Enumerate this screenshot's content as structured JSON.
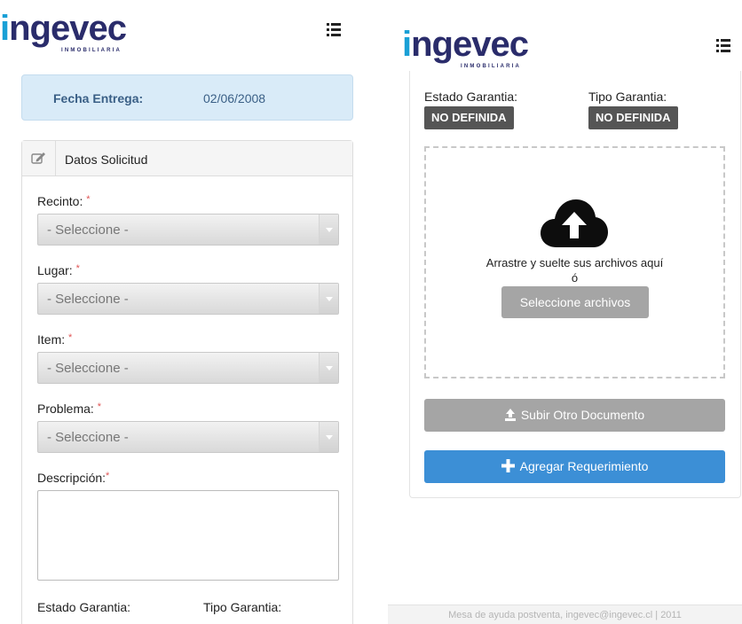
{
  "brand": {
    "logo_text": "ingevec",
    "logo_lead": "i",
    "logo_rest": "ngevec",
    "logo_sub": "INMOBILIARIA"
  },
  "left": {
    "fecha_label": "Fecha Entrega:",
    "fecha_value": "02/06/2008",
    "panel_title": "Datos Solicitud",
    "fields": [
      {
        "label": "Recinto:",
        "required": "*",
        "value": "- Seleccione -"
      },
      {
        "label": "Lugar:",
        "required": "*",
        "value": "- Seleccione -"
      },
      {
        "label": "Item:",
        "required": "*",
        "value": "- Seleccione -"
      },
      {
        "label": "Problema:",
        "required": "*",
        "value": "- Seleccione -"
      }
    ],
    "descripcion_label": "Descripción:",
    "descripcion_required": "*",
    "estado_label": "Estado Garantia:",
    "tipo_label": "Tipo Garantia:"
  },
  "right": {
    "estado_label": "Estado Garantia:",
    "estado_value": "NO DEFINIDA",
    "tipo_label": "Tipo Garantia:",
    "tipo_value": "NO DEFINIDA",
    "drop_text": "Arrastre y suelte sus archivos aquí",
    "drop_or": "ó",
    "select_files_label": "Seleccione archivos",
    "upload_other_label": "Subir Otro Documento",
    "add_requirement_label": "Agregar Requerimiento",
    "footer_text": "Mesa de ayuda postventa, ingevec@ingevec.cl | 2011"
  },
  "colors": {
    "brand_navy": "#2a2c6b",
    "brand_blue": "#1aa0d6",
    "primary_button": "#3c8fd6",
    "info_box": "#d9ebf8"
  },
  "icons": {
    "menu": "list-menu-icon",
    "panel": "edit-icon",
    "upload": "cloud-upload-icon",
    "upload_button": "upload-arrow-icon",
    "add": "plus-icon",
    "select": "chevron-down-icon"
  }
}
